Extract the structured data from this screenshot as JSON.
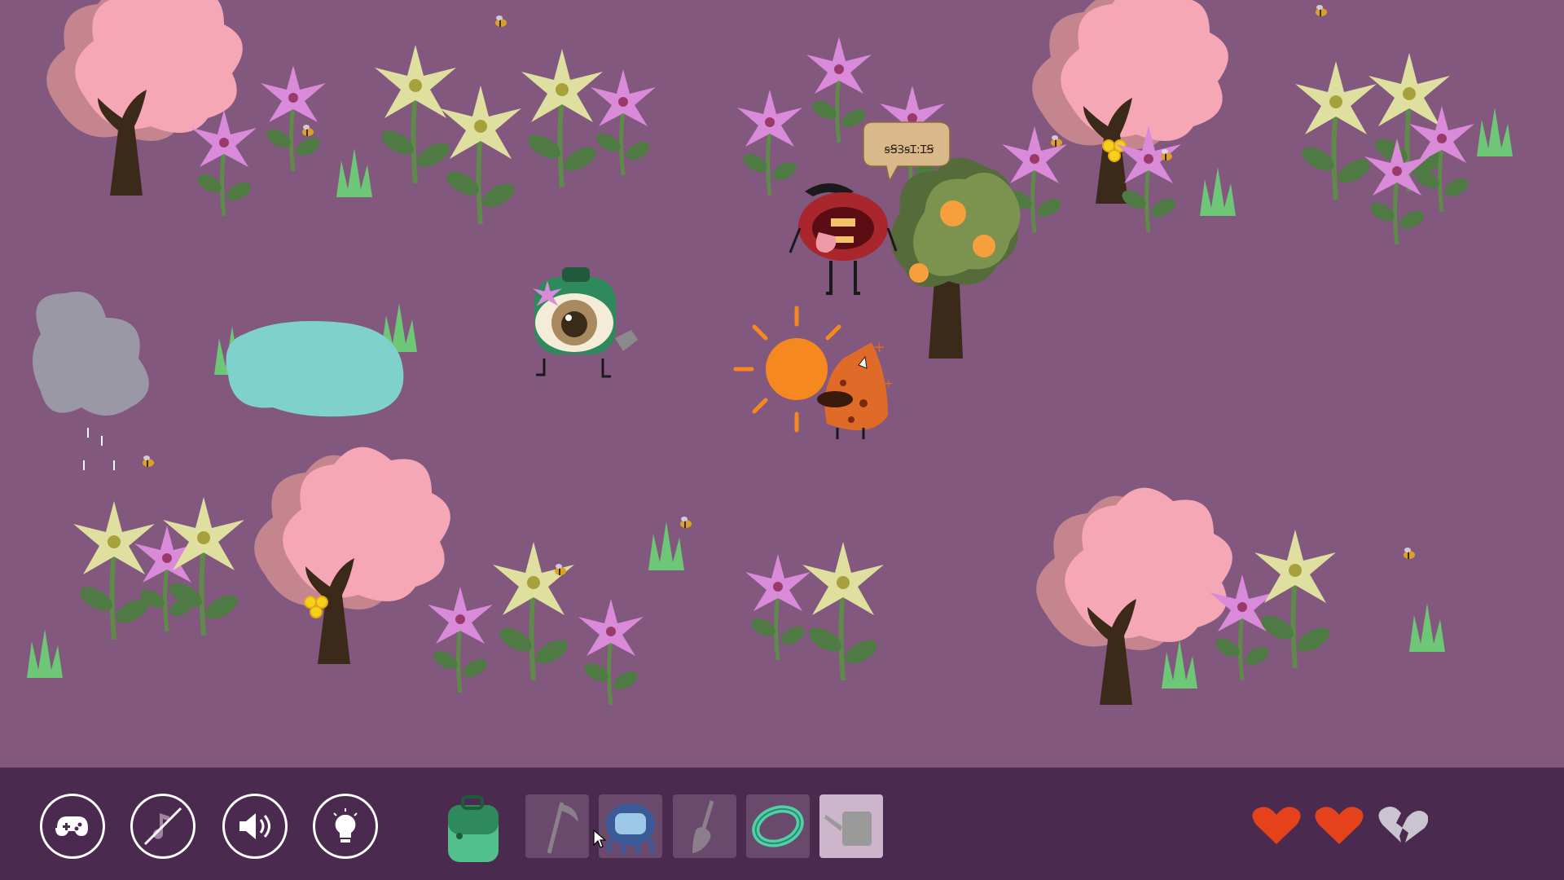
{
  "game": {
    "speech_bubble_text": "ꞩꞨꞫꞩꞮ:ꞮꞨ",
    "colors": {
      "background": "#83587f",
      "hud_bar": "#4b2a4f",
      "blossom": "#f5a7b5",
      "trunk": "#3b2a1a",
      "lily_pink": "#d98ad8",
      "lily_yellow": "#dfe0a0",
      "leaf": "#5e8a4a",
      "grass": "#6ec776",
      "pond": "#7fd1cc",
      "cloud": "#9b98a5",
      "sun": "#f5891f",
      "heart_full": "#e5421c",
      "heart_broken": "#c9c4d0"
    }
  },
  "hud": {
    "buttons": [
      {
        "name": "controller-button",
        "icon": "controller-icon"
      },
      {
        "name": "music-toggle-button",
        "icon": "music-off-icon"
      },
      {
        "name": "sound-button",
        "icon": "speaker-icon"
      },
      {
        "name": "hint-button",
        "icon": "lightbulb-icon"
      }
    ],
    "inventory": [
      {
        "name": "backpack",
        "icon": "backpack-icon",
        "state": "active"
      },
      {
        "name": "scythe",
        "icon": "scythe-icon",
        "state": "dim"
      },
      {
        "name": "robot",
        "icon": "robot-icon",
        "state": "dim"
      },
      {
        "name": "shovel",
        "icon": "shovel-icon",
        "state": "dim"
      },
      {
        "name": "bracelet",
        "icon": "bracelet-icon",
        "state": "dim"
      },
      {
        "name": "watering-can",
        "icon": "watering-can-icon",
        "state": "selected"
      }
    ],
    "lives": {
      "total": 3,
      "remaining": 2
    }
  }
}
